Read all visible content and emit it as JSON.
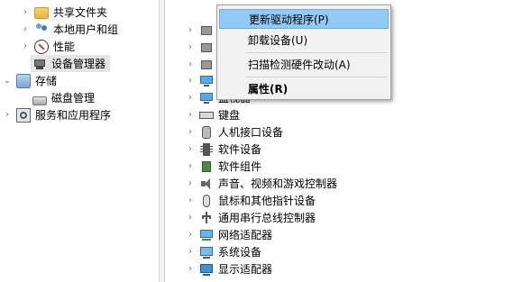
{
  "left_tree": {
    "items": [
      {
        "label": "共享文件夹",
        "expander": "›",
        "icon": "shared-folder-icon"
      },
      {
        "label": "本地用户和组",
        "expander": "›",
        "icon": "users-icon"
      },
      {
        "label": "性能",
        "expander": "›",
        "icon": "performance-icon"
      },
      {
        "label": "设备管理器",
        "expander": "",
        "icon": "device-manager-icon",
        "selected": true
      },
      {
        "label": "存储",
        "expander": "⌄",
        "icon": "storage-icon"
      },
      {
        "label": "磁盘管理",
        "expander": "",
        "icon": "disk-icon"
      },
      {
        "label": "服务和应用程序",
        "expander": "›",
        "icon": "services-icon"
      }
    ]
  },
  "device_tree": {
    "items": [
      {
        "label": "",
        "icon": "generic-device-icon"
      },
      {
        "label": "",
        "icon": "generic-device-icon"
      },
      {
        "label": "",
        "icon": "generic-device-icon"
      },
      {
        "label": "",
        "icon": "monitor-icon"
      },
      {
        "label": "监视器",
        "icon": "monitor-icon"
      },
      {
        "label": "键盘",
        "icon": "keyboard-icon"
      },
      {
        "label": "人机接口设备",
        "icon": "hid-icon"
      },
      {
        "label": "软件设备",
        "icon": "software-device-icon"
      },
      {
        "label": "软件组件",
        "icon": "software-component-icon"
      },
      {
        "label": "声音、视频和游戏控制器",
        "icon": "sound-icon"
      },
      {
        "label": "鼠标和其他指针设备",
        "icon": "mouse-icon"
      },
      {
        "label": "通用串行总线控制器",
        "icon": "usb-icon"
      },
      {
        "label": "网络适配器",
        "icon": "network-adapter-icon"
      },
      {
        "label": "系统设备",
        "icon": "system-device-icon"
      },
      {
        "label": "显示适配器",
        "icon": "display-adapter-icon"
      }
    ],
    "expander": "›"
  },
  "context_menu": {
    "items": [
      {
        "label": "更新驱动程序(P)",
        "highlighted": true
      },
      {
        "label": "卸载设备(U)"
      },
      {
        "label": "扫描检测硬件改动(A)"
      },
      {
        "label": "属性(R)",
        "bold": true
      }
    ]
  }
}
